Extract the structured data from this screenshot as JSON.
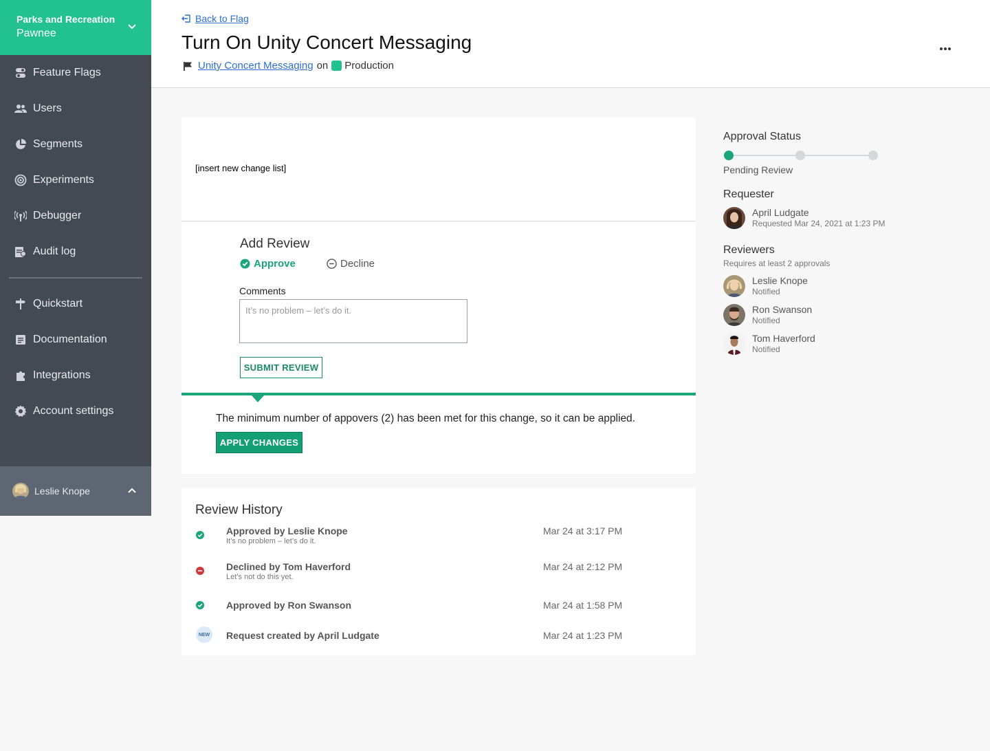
{
  "project": {
    "line1": "Parks and Recreation",
    "line2": "Pawnee"
  },
  "nav": [
    {
      "label": "Feature Flags",
      "icon": "toggle-icon"
    },
    {
      "label": "Users",
      "icon": "users-icon"
    },
    {
      "label": "Segments",
      "icon": "pie-icon"
    },
    {
      "label": "Experiments",
      "icon": "target-icon"
    },
    {
      "label": "Debugger",
      "icon": "broadcast-icon"
    },
    {
      "label": "Audit log",
      "icon": "audit-icon"
    }
  ],
  "nav2": [
    {
      "label": "Quickstart",
      "icon": "signpost-icon"
    },
    {
      "label": "Documentation",
      "icon": "document-icon"
    },
    {
      "label": "Integrations",
      "icon": "puzzle-icon"
    },
    {
      "label": "Account settings",
      "icon": "gear-icon"
    }
  ],
  "current_user": {
    "name": "Leslie Knope"
  },
  "header": {
    "back_label": "Back to Flag",
    "title": "Turn On Unity Concert Messaging",
    "flag_link": "Unity Concert Messaging",
    "on_text": "on",
    "environment": "Production",
    "env_color": "#21c28e"
  },
  "main": {
    "change_list": "[insert new change list]",
    "add_review_title": "Add Review",
    "approve_label": "Approve",
    "decline_label": "Decline",
    "comments_label": "Comments",
    "comments_placeholder": "It’s no problem – let’s do it.",
    "submit_label": "SUBMIT REVIEW",
    "min_message": "The minimum number of appovers (2) has been met for this change, so it can be applied.",
    "apply_label": "APPLY CHANGES"
  },
  "history": {
    "title": "Review History",
    "items": [
      {
        "type": "approved",
        "text": "Approved by Leslie Knope",
        "comment": "It’s no problem – let’s do it.",
        "date": "Mar 24 at 3:17 PM"
      },
      {
        "type": "declined",
        "text": "Declined by Tom Haverford",
        "comment": "Let’s not do this yet.",
        "date": "Mar 24 at 2:12 PM"
      },
      {
        "type": "approved",
        "text": "Approved by Ron Swanson",
        "comment": "",
        "date": "Mar 24 at 1:58 PM"
      },
      {
        "type": "new",
        "badge": "NEW",
        "text": "Request created by April Ludgate",
        "comment": "",
        "date": "Mar 24 at 1:23 PM"
      }
    ]
  },
  "approval": {
    "title": "Approval Status",
    "status": "Pending Review",
    "steps_completed": 1,
    "steps_total": 3
  },
  "requester": {
    "title": "Requester",
    "name": "April Ludgate",
    "sub": "Requested Mar 24, 2021 at 1:23 PM"
  },
  "reviewers": {
    "title": "Reviewers",
    "requirement": "Requires at least 2 approvals",
    "items": [
      {
        "name": "Leslie Knope",
        "status": "Notified"
      },
      {
        "name": "Ron Swanson",
        "status": "Notified"
      },
      {
        "name": "Tom Haverford",
        "status": "Notified"
      }
    ]
  },
  "colors": {
    "accent": "#21c28e",
    "approve": "#1aa57a",
    "decline": "#d03a3a",
    "link": "#2e6fd1",
    "sidebar": "#434a54"
  }
}
